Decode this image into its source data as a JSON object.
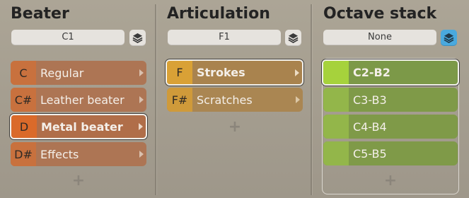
{
  "beater": {
    "title": "Beater",
    "selected_key": "C1",
    "stack_icon": "layers-icon",
    "items": [
      {
        "note": "C",
        "label": "Regular",
        "selected": false
      },
      {
        "note": "C#",
        "label": "Leather beater",
        "selected": false
      },
      {
        "note": "D",
        "label": "Metal beater",
        "selected": true
      },
      {
        "note": "D#",
        "label": "Effects",
        "selected": false
      }
    ],
    "add_label": "+"
  },
  "articulation": {
    "title": "Articulation",
    "selected_key": "F1",
    "stack_icon": "layers-icon",
    "items": [
      {
        "note": "F",
        "label": "Strokes",
        "selected": true
      },
      {
        "note": "F#",
        "label": "Scratches",
        "selected": false
      }
    ],
    "add_label": "+"
  },
  "octave": {
    "title": "Octave stack",
    "selected_key": "None",
    "stack_icon": "layers-icon",
    "stack_active": true,
    "items": [
      {
        "label": "C2-B2",
        "selected": true
      },
      {
        "label": "C3-B3",
        "selected": false
      },
      {
        "label": "C4-B4",
        "selected": false
      },
      {
        "label": "C5-B5",
        "selected": false
      }
    ],
    "add_label": "+"
  },
  "colors": {
    "beater_row": "#ad7554",
    "beater_note": "#c8713e",
    "beater_selected_note": "#da6a2a",
    "articulation_row": "#aa8652",
    "articulation_note": "#cf9a3a",
    "octave_row": "#7f9a48",
    "octave_note": "#93b64a",
    "octave_selected_note": "#a6d23c",
    "active_stack": "#4aa9de"
  }
}
